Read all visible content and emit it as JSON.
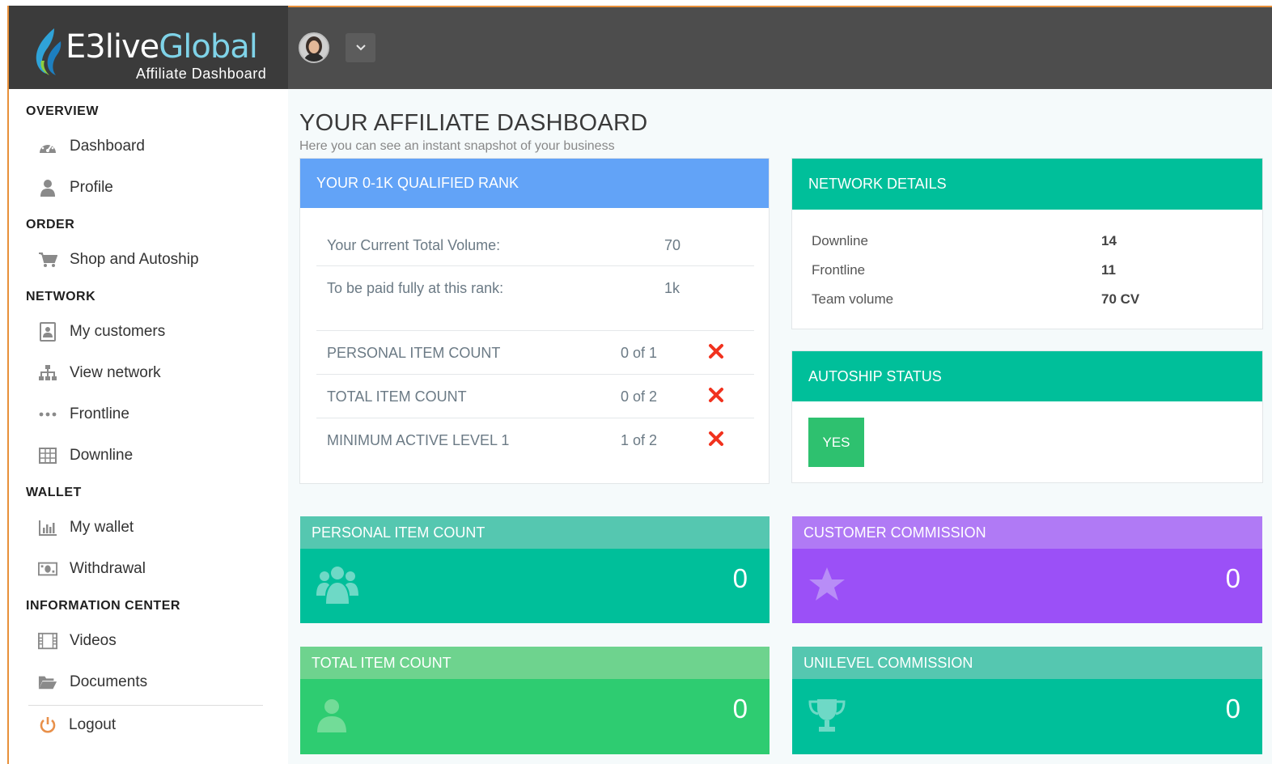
{
  "brand": {
    "logo_main": "E3live",
    "logo_accent": "Global",
    "logo_sub": "Affiliate Dashboard"
  },
  "sidebar": {
    "sections": [
      {
        "heading": "OVERVIEW",
        "items": [
          {
            "label": "Dashboard",
            "icon": "dashboard-gauge-icon"
          },
          {
            "label": "Profile",
            "icon": "user-icon"
          }
        ]
      },
      {
        "heading": "ORDER",
        "items": [
          {
            "label": "Shop and Autoship",
            "icon": "shopping-cart-icon"
          }
        ]
      },
      {
        "heading": "NETWORK",
        "items": [
          {
            "label": "My customers",
            "icon": "contact-card-icon"
          },
          {
            "label": "View network",
            "icon": "sitemap-icon"
          },
          {
            "label": "Frontline",
            "icon": "ellipsis-icon"
          },
          {
            "label": "Downline",
            "icon": "table-grid-icon"
          }
        ]
      },
      {
        "heading": "WALLET",
        "items": [
          {
            "label": "My wallet",
            "icon": "bar-chart-icon"
          },
          {
            "label": "Withdrawal",
            "icon": "money-bill-icon"
          }
        ]
      },
      {
        "heading": "INFORMATION CENTER",
        "items": [
          {
            "label": "Videos",
            "icon": "film-icon"
          },
          {
            "label": "Documents",
            "icon": "folder-open-icon"
          }
        ]
      }
    ],
    "logout_label": "Logout"
  },
  "main": {
    "title": "YOUR AFFILIATE DASHBOARD",
    "subtitle": "Here you can see an instant snapshot of your business",
    "rank_panel": {
      "title": "YOUR 0-1K QUALIFIED RANK",
      "color": "#62a3f7",
      "current_volume_label": "Your Current Total Volume:",
      "current_volume_value": "70",
      "paid_fully_label": "To be paid fully at this rank:",
      "paid_fully_value": "1k",
      "requirements": [
        {
          "label": "PERSONAL ITEM COUNT",
          "value": "0 of 1",
          "met": false
        },
        {
          "label": "TOTAL ITEM COUNT",
          "value": "0 of 2",
          "met": false
        },
        {
          "label": "MINIMUM ACTIVE LEVEL 1",
          "value": "1 of 2",
          "met": false
        }
      ]
    },
    "network_panel": {
      "title": "NETWORK DETAILS",
      "color": "#00bf9a",
      "rows": [
        {
          "label": "Downline",
          "value": "14"
        },
        {
          "label": "Frontline",
          "value": "11"
        },
        {
          "label": "Team volume",
          "value": "70 CV"
        }
      ]
    },
    "autoship_panel": {
      "title": "AUTOSHIP STATUS",
      "color": "#00bf9a",
      "status": "YES"
    },
    "stats": [
      {
        "title": "PERSONAL ITEM COUNT",
        "value": "0",
        "icon": "users-group-icon",
        "head_color": "#55c7b0",
        "body_color": "#00bf9a"
      },
      {
        "title": "CUSTOMER COMMISSION",
        "value": "0",
        "icon": "star-icon",
        "head_color": "#b07af5",
        "body_color": "#9b50f7"
      },
      {
        "title": "TOTAL ITEM COUNT",
        "value": "0",
        "icon": "user-icon",
        "head_color": "#6ed38e",
        "body_color": "#2ecc71"
      },
      {
        "title": "UNILEVEL COMMISSION",
        "value": "0",
        "icon": "trophy-icon",
        "head_color": "#55c7b0",
        "body_color": "#00bf9a"
      }
    ]
  }
}
